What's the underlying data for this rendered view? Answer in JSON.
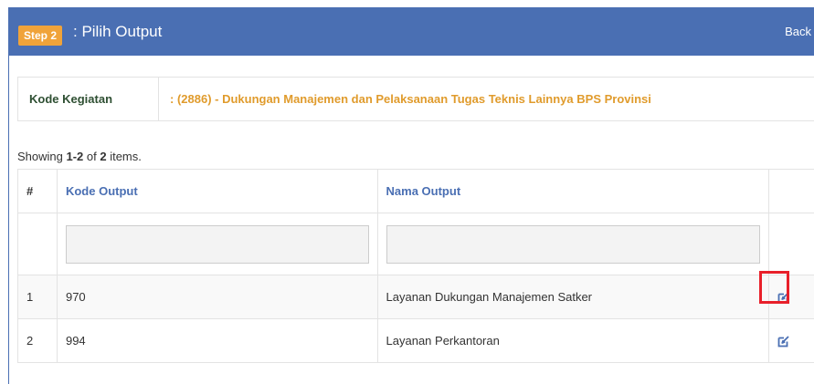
{
  "header": {
    "step_badge": "Step 2",
    "title": ": Pilih Output",
    "back_label": "Back"
  },
  "info": {
    "label": "Kode Kegiatan",
    "value": ": (2886) - Dukungan Manajemen dan Pelaksanaan Tugas Teknis Lainnya BPS Provinsi"
  },
  "summary": {
    "prefix": "Showing ",
    "range": "1-2",
    "middle": " of ",
    "total": "2",
    "suffix": " items."
  },
  "table": {
    "headers": {
      "num": "#",
      "kode_output": "Kode Output",
      "nama_output": "Nama Output"
    },
    "filters": {
      "kode_output": "",
      "nama_output": ""
    },
    "rows": [
      {
        "num": "1",
        "kode": "970",
        "nama": "Layanan Dukungan Manajemen Satker",
        "action_icon": "edit-icon",
        "highlighted": true
      },
      {
        "num": "2",
        "kode": "994",
        "nama": "Layanan Perkantoran",
        "action_icon": "edit-icon",
        "highlighted": false
      }
    ]
  },
  "colors": {
    "heading_bg": "#4a6fb3",
    "badge_bg": "#f0a33a",
    "info_value": "#e09b2c",
    "info_label": "#2e4f32",
    "highlight": "#e8202a"
  }
}
